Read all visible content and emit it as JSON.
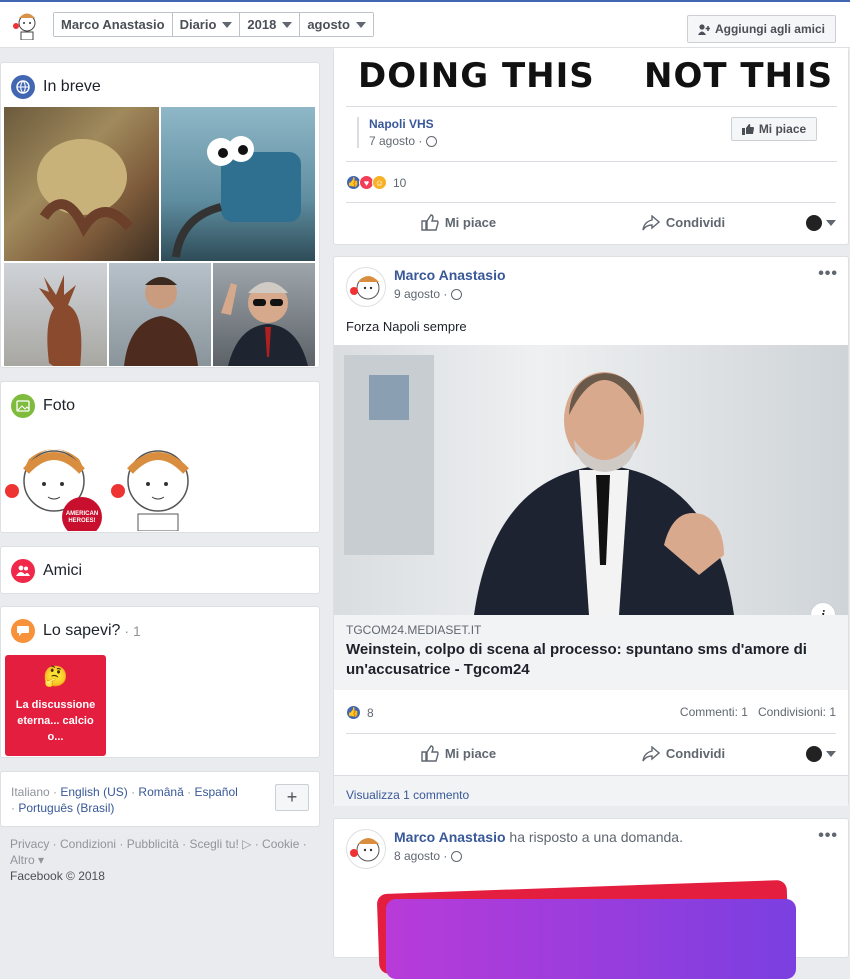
{
  "topbar": {
    "crumbs": [
      "Marco Anastasio",
      "Diario",
      "2018",
      "agosto"
    ],
    "add_friend": "Aggiungi agli amici"
  },
  "left": {
    "inbreve": {
      "title": "In breve"
    },
    "foto": {
      "title": "Foto",
      "badge_text": "I support our\nAMERICAN\nHEROES!"
    },
    "amici": {
      "title": "Amici"
    },
    "losapevi": {
      "title": "Lo sapevi?",
      "count": "· 1",
      "card_text": "La discussione eterna... calcio o...",
      "card_emoji": "🤔"
    },
    "languages": {
      "items": [
        "Italiano",
        "English (US)",
        "Română",
        "Español",
        "Português (Brasil)"
      ],
      "plus": "+"
    },
    "footer": {
      "links": [
        "Privacy",
        "Condizioni",
        "Pubblicità",
        "Scegli tu!",
        "Cookie",
        "Altro"
      ],
      "copyright": "Facebook © 2018"
    }
  },
  "post1": {
    "meme_left": "DOING THIS",
    "meme_right": "NOT THIS",
    "page_name": "Napoli VHS",
    "page_date": "7 agosto ·",
    "like_page": "Mi piace",
    "react_count": "10",
    "like": "Mi piace",
    "share": "Condividi"
  },
  "post2": {
    "author": "Marco Anastasio",
    "date": "9 agosto ·",
    "text": "Forza Napoli sempre",
    "link_domain": "TGCOM24.MEDIASET.IT",
    "link_title": "Weinstein, colpo di scena al processo: spuntano sms d'amore di un'accusatrice - Tgcom24",
    "react_count": "8",
    "comments": "Commenti: 1",
    "shares": "Condivisioni: 1",
    "like": "Mi piace",
    "share": "Condividi",
    "view_comments": "Visualizza 1 commento",
    "info": "i"
  },
  "post3": {
    "author": "Marco Anastasio",
    "action": "ha risposto a una domanda.",
    "date": "8 agosto ·"
  },
  "colors": {
    "link": "#385898",
    "brand": "#4267b2",
    "red": "#e41e3f"
  }
}
